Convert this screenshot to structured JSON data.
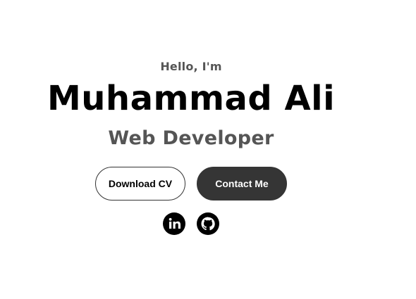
{
  "hero": {
    "greeting": "Hello, I'm",
    "name": "Muhammad Ali",
    "role": "Web Developer"
  },
  "buttons": {
    "download_label": "Download CV",
    "contact_label": "Contact Me"
  },
  "socials": [
    {
      "icon": "linkedin-icon"
    },
    {
      "icon": "github-icon"
    }
  ],
  "colors": {
    "background": "#ffffff",
    "text_primary": "#000000",
    "text_secondary": "#555555",
    "button_dark": "#353535"
  }
}
